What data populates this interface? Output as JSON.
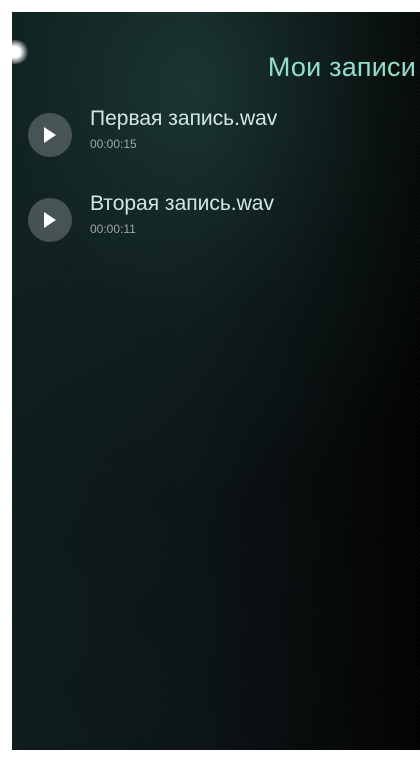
{
  "header": {
    "title": "Мои записи",
    "title_color": "#8fe0c8"
  },
  "pulley_indicator": {
    "icon": "pulley-menu-glow-icon"
  },
  "recordings": [
    {
      "name": "Первая запись.wav",
      "duration": "00:00:15",
      "icon": "play-icon"
    },
    {
      "name": "Вторая запись.wav",
      "duration": "00:00:11",
      "icon": "play-icon"
    }
  ],
  "colors": {
    "background_dark": "#000000",
    "accent": "#8fe0c8",
    "play_button_bg": "#5a6464"
  }
}
